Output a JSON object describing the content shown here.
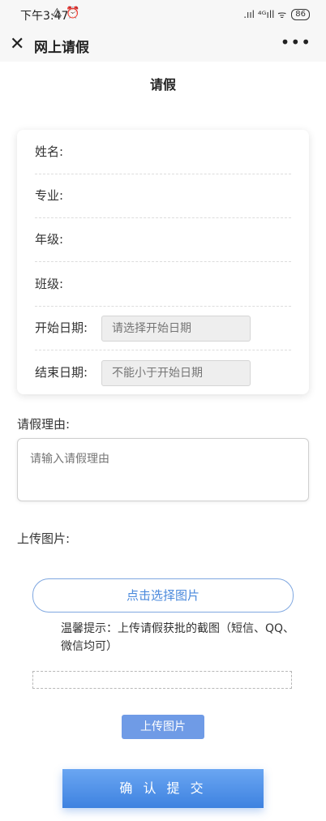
{
  "status_bar": {
    "time": "下午3:47",
    "left_icons": "⚠ ⏰",
    "signal": ".ııl ⁴ᴳıll ᯤ",
    "battery": "86"
  },
  "nav": {
    "close_icon": "close-icon",
    "title": "网上请假",
    "more": "•••"
  },
  "page": {
    "title": "请假"
  },
  "form": {
    "name_label": "姓名:",
    "major_label": "专业:",
    "grade_label": "年级:",
    "class_label": "班级:",
    "start_label": "开始日期:",
    "start_placeholder": "请选择开始日期",
    "end_label": "结束日期:",
    "end_placeholder": "不能小于开始日期"
  },
  "reason": {
    "label": "请假理由:",
    "placeholder": "请输入请假理由"
  },
  "upload": {
    "label": "上传图片:",
    "choose_button": "点击选择图片",
    "hint": "温馨提示：上传请假获批的截图（短信、QQ、微信均可）",
    "upload_button": "上传图片"
  },
  "submit": {
    "label": "确 认 提 交"
  },
  "colors": {
    "accent": "#4a89dc",
    "upload_bg": "#6f9be6"
  }
}
